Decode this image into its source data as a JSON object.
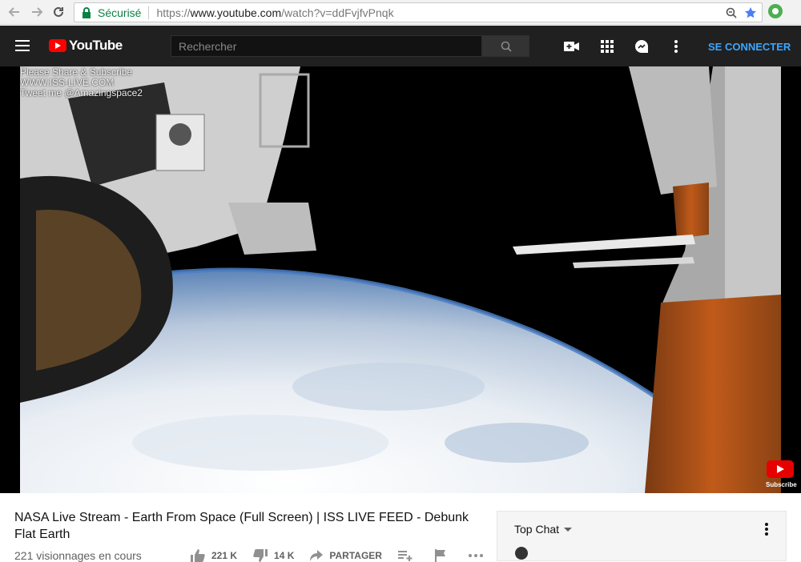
{
  "browser": {
    "secure_label": "Sécurisé",
    "url_scheme": "https://",
    "url_host": "www.youtube.com",
    "url_path": "/watch?v=ddFvjfvPnqk"
  },
  "header": {
    "logo_text": "YouTube",
    "search_placeholder": "Rechercher",
    "signin_label": "SE CONNECTER"
  },
  "player": {
    "overlay_lines": [
      "Please Share & Subscribe",
      "WWW.ISS-LIVE.COM",
      "Tweet me @Amazingspace2"
    ],
    "watermark_label": "Subscribe"
  },
  "video": {
    "title": "NASA Live Stream - Earth From Space (Full Screen) | ISS LIVE FEED - Debunk Flat Earth",
    "views": "221 visionnages en cours",
    "likes": "221 K",
    "dislikes": "14 K",
    "share_label": "PARTAGER"
  },
  "chat": {
    "title": "Top Chat"
  },
  "colors": {
    "yt_red": "#ff0000",
    "header_bg": "#202020",
    "signin_blue": "#3ea6ff",
    "secure_green": "#0b8043"
  }
}
